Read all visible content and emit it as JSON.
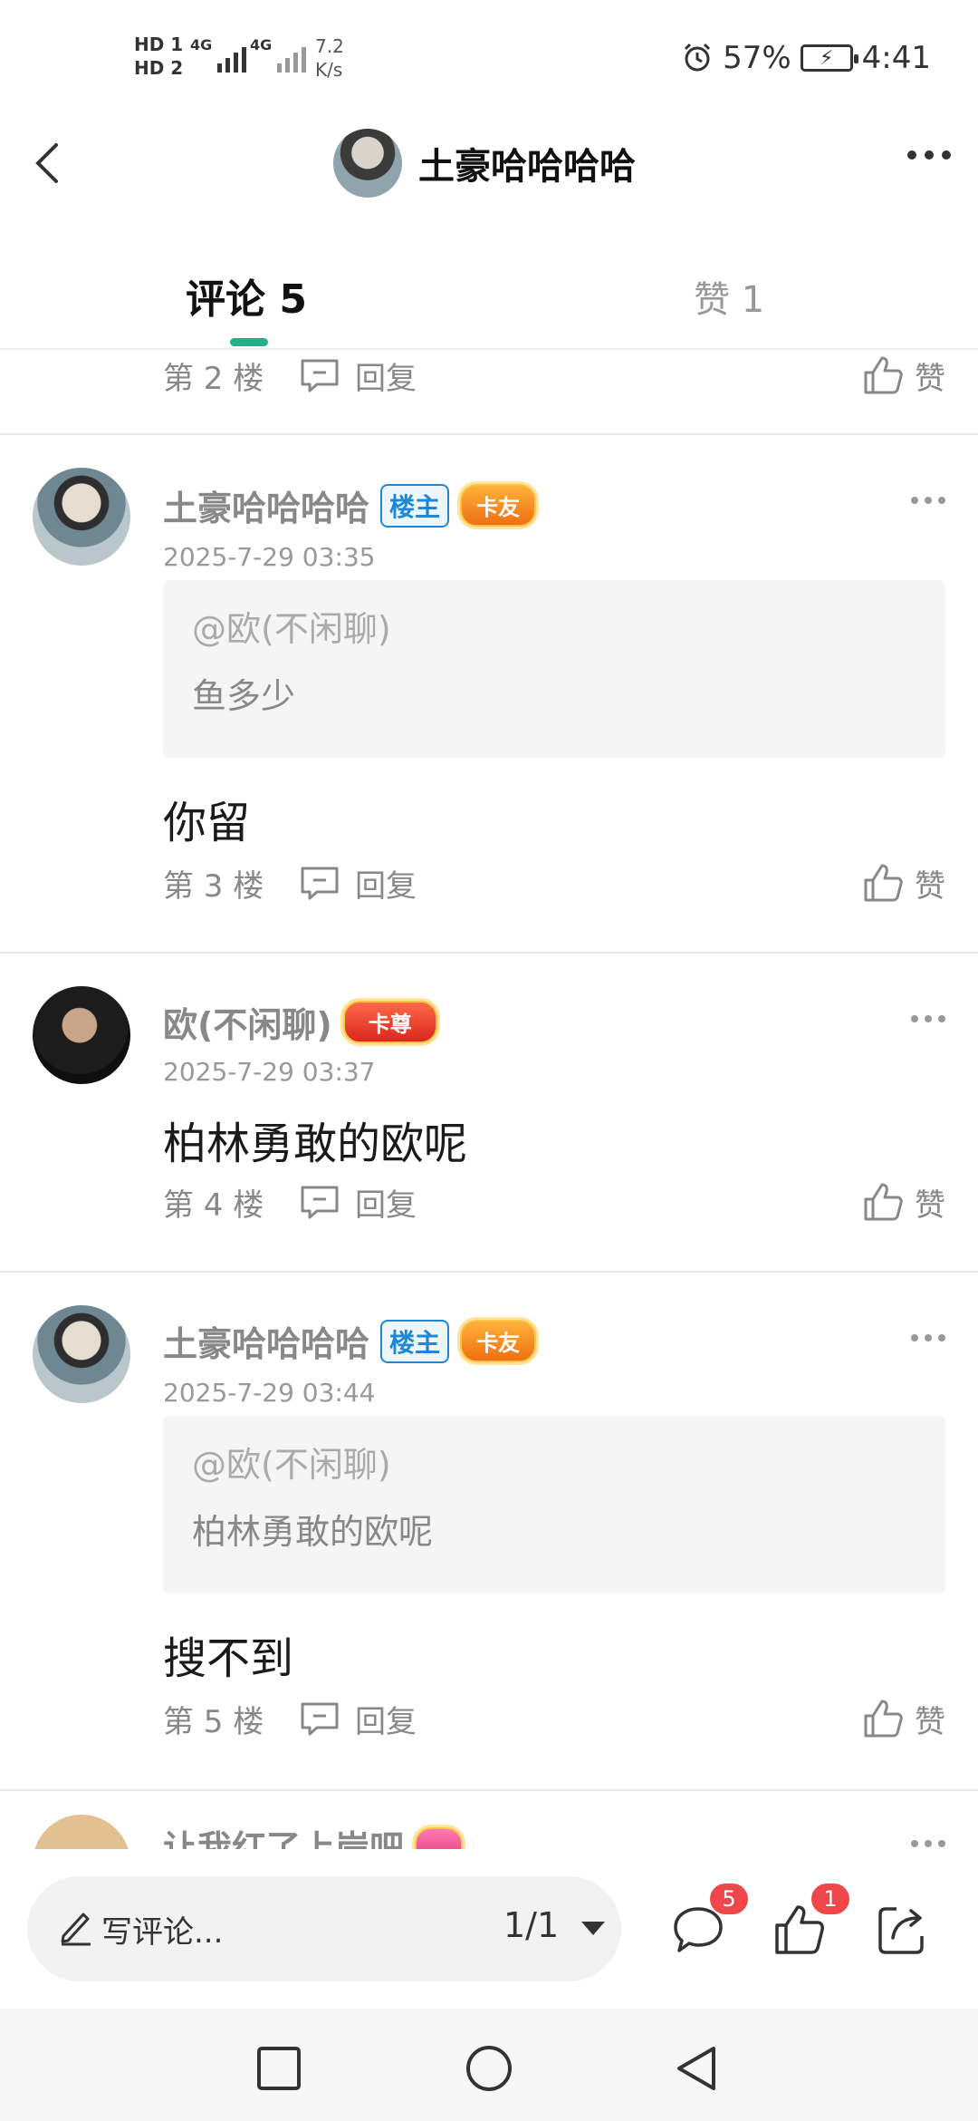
{
  "status_bar": {
    "hd1": "HD 1",
    "hd2": "HD 2",
    "net1": "4G",
    "net2": "4G",
    "speed_value": "7.2",
    "speed_unit": "K/s",
    "battery": "57%",
    "time": "4:41"
  },
  "header": {
    "title": "土豪哈哈哈哈"
  },
  "tabs": {
    "comments": "评论 5",
    "likes": "赞 1"
  },
  "labels": {
    "reply": "回复",
    "like": "赞"
  },
  "partial_top": {
    "floor": "第 2 楼"
  },
  "comments": [
    {
      "nick": "土豪哈哈哈哈",
      "owner_badge": "楼主",
      "level_badge": "卡友",
      "time": "2025-7-29 03:35",
      "quote_at": "@欧(不闲聊)",
      "quote_text": "鱼多少",
      "content": "你留",
      "floor": "第 3 楼"
    },
    {
      "nick": "欧(不闲聊)",
      "level_badge": "卡尊",
      "time": "2025-7-29 03:37",
      "content": "柏林勇敢的欧呢",
      "floor": "第 4 楼"
    },
    {
      "nick": "土豪哈哈哈哈",
      "owner_badge": "楼主",
      "level_badge": "卡友",
      "time": "2025-7-29 03:44",
      "quote_at": "@欧(不闲聊)",
      "quote_text": "柏林勇敢的欧呢",
      "content": "搜不到",
      "floor": "第 5 楼"
    },
    {
      "nick": "让我红了上岸吧"
    }
  ],
  "bottom": {
    "write_placeholder": "写评论...",
    "page": "1/1",
    "comment_count": "5",
    "like_count": "1"
  },
  "colors": {
    "accent": "#25b08b",
    "owner_badge": "#1e88d6",
    "notify_badge": "#f0474a"
  }
}
